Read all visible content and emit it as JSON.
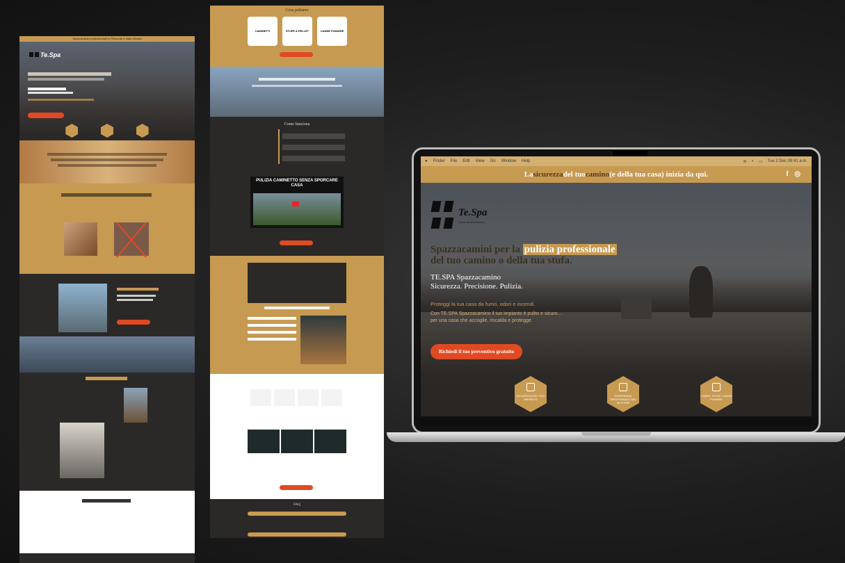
{
  "laptop": {
    "menubar": {
      "items": [
        "Finder",
        "File",
        "Edit",
        "View",
        "Go",
        "Window",
        "Help"
      ],
      "datetime": "Tue 2 Dec 09:41 a.m."
    },
    "announce": {
      "text_pre": "La ",
      "text_hl": "sicurezza",
      "text_mid": " del tuo ",
      "text_hl2": "camino",
      "text_post": " (e della tua casa) inizia da qui.",
      "social_icons": [
        "facebook-icon",
        "instagram-icon"
      ]
    },
    "logo": {
      "name": "Te.Spa",
      "subtitle": "Tessa Spazzacamino"
    },
    "hero": {
      "headline_pre": "Spazzacamini per la ",
      "headline_hl": "pulizia professionale",
      "headline_post": "del tuo camino o della tua stufa.",
      "sub_line1": "TE.SPA Spazzacamino",
      "sub_line2": "Sicurezza. Precisione. Pulizia.",
      "tagline": "Proteggi la tua casa da fumo, odori e incendi.",
      "desc_line1": "Con TE.SPA Spazzacamino il tuo impianto è pulito e sicuro…",
      "desc_line2": "per una casa che accoglie, riscalda e protegge.",
      "cta": "Richiedi il tuo preventivo gratuito"
    },
    "badges": [
      {
        "label": "SICUREZZA DEL TUO IMPIANTO",
        "icon": "shield-icon"
      },
      {
        "label": "ESPERIENZA TRENTENNALE NEL SETTORE",
        "icon": "medal-icon"
      },
      {
        "label": "CAMINI, STUFE, CANNE FUMARIE",
        "icon": "chimney-icon"
      }
    ]
  },
  "mid": {
    "section1_title": "Cosa puliamo",
    "section1_cards": [
      "CAMINETTI",
      "STUFE A PELLET",
      "CANNE FUMARIE"
    ],
    "how_title": "Come funziona",
    "video_title": "PULIZIA CAMINETTO SENZA SPORCARE CASA",
    "faq_title": "FAQ"
  },
  "left": {
    "topbar": "Spazzacamini professionisti in Piemonte e Valle d'Aosta",
    "logo": "Te.Spa"
  }
}
